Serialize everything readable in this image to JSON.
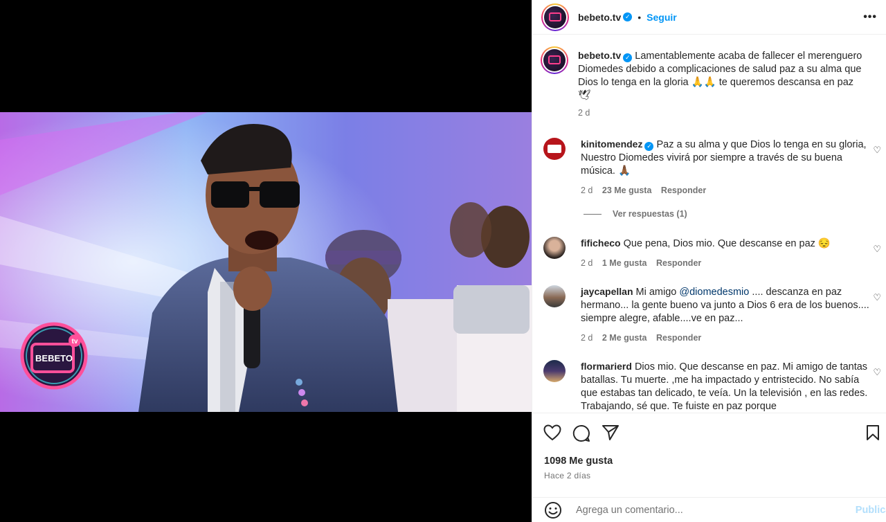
{
  "post": {
    "author": "bebeto.tv",
    "follow_label": "Seguir",
    "more_label": "•••",
    "caption": "Lamentablemente acaba de fallecer el merenguero Diomedes debido a complicaciones de salud paz a su alma que Dios lo tenga en la gloria 🙏🙏 te queremos descansa en paz 🕊",
    "caption_time": "2 d",
    "likes": "1098 Me gusta",
    "posted": "Hace 2 días"
  },
  "comments": [
    {
      "user": "kinitomendez",
      "verified": true,
      "text": "Paz a su alma y que Dios lo tenga en su gloria, Nuestro Diomedes vivirá por siempre a través de su buena música. 🙏🏾",
      "time": "2 d",
      "likes": "23 Me gusta",
      "reply": "Responder"
    },
    {
      "user": "fificheco",
      "text": "Que pena, Dios mio. Que descanse en paz 😔",
      "time": "2 d",
      "likes": "1 Me gusta",
      "reply": "Responder"
    },
    {
      "user": "jaycapellan",
      "text_pre": "Mi amigo ",
      "mention": "@diomedesmio",
      "text_post": " .... descanza en paz hermano... la gente bueno va junto a Dios 6 era de los buenos.... siempre alegre, afable....ve en paz...",
      "time": "2 d",
      "likes": "2 Me gusta",
      "reply": "Responder"
    },
    {
      "user": "flormarierd",
      "text": "Dios mio. Que descanse en paz. Mi amigo de tantas batallas. Tu muerte. ,me ha impactado y entristecido. No sabía que estabas tan delicado, te veía. Un la televisión , en las redes. Trabajando, sé que. Te fuiste en paz porque"
    }
  ],
  "view_replies": "Ver respuestas (1)",
  "comment_box": {
    "placeholder": "Agrega un comentario...",
    "publish": "Publicar"
  },
  "watermark": "BEBETO TV",
  "icons": {
    "like": "heart-icon",
    "comment": "comment-icon",
    "share": "send-icon",
    "save": "bookmark-icon",
    "emoji": "emoji-icon"
  },
  "colors": {
    "accent": "#0095f6",
    "publish_disabled": "#b2dffc",
    "muted": "#737373"
  }
}
